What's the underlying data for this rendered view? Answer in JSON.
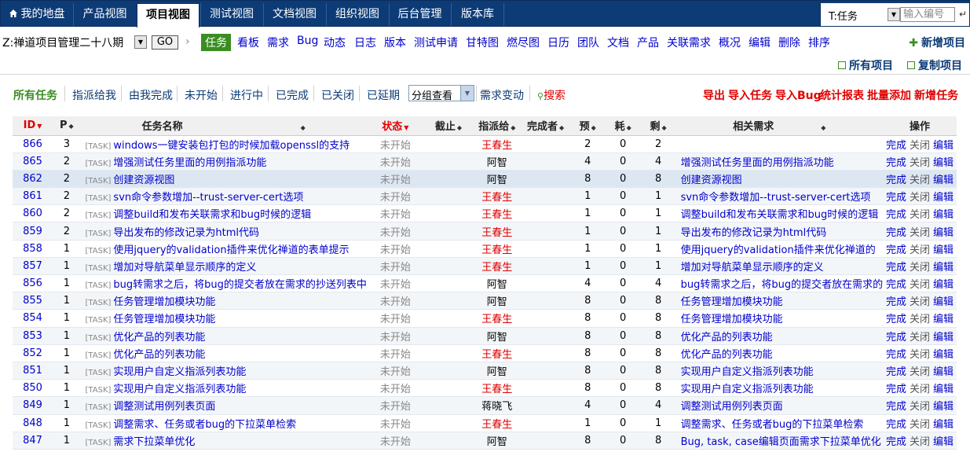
{
  "topnav": {
    "tabs": [
      {
        "label": "我的地盘",
        "icon": "home-icon"
      },
      {
        "label": "产品视图"
      },
      {
        "label": "项目视图",
        "active": true
      },
      {
        "label": "测试视图"
      },
      {
        "label": "文档视图"
      },
      {
        "label": "组织视图"
      },
      {
        "label": "后台管理"
      },
      {
        "label": "版本库"
      }
    ],
    "type_select": "T:任务",
    "number_placeholder": "输入编号"
  },
  "subnav": {
    "project_name": "Z:禅道项目管理二十八期",
    "go_label": "GO",
    "links": [
      "任务",
      "看板",
      "需求",
      "Bug",
      "动态",
      "日志",
      "版本",
      "测试申请",
      "甘特图",
      "燃尽图",
      "日历",
      "团队",
      "文档",
      "产品",
      "关联需求",
      "概况",
      "编辑",
      "删除",
      "排序"
    ],
    "add_project": "新增项目",
    "all_projects": "所有项目",
    "copy_project": "复制项目"
  },
  "filters": {
    "items": [
      "所有任务",
      "指派给我",
      "由我完成",
      "未开始",
      "进行中",
      "已完成",
      "已关闭",
      "已延期"
    ],
    "group_select": "分组查看",
    "story_change": "需求变动",
    "search": "搜索",
    "actions": [
      "导出",
      "导入任务",
      "导入Bug",
      "统计报表",
      "批量添加",
      "新增任务"
    ]
  },
  "table": {
    "headers": [
      "ID",
      "P",
      "任务名称",
      "状态",
      "截止",
      "指派给",
      "完成者",
      "预",
      "耗",
      "剩",
      "相关需求",
      "操作"
    ],
    "tag": "[TASK]",
    "action_labels": {
      "done": "完成",
      "close": "关闭",
      "edit": "编辑"
    },
    "rows": [
      {
        "id": "866",
        "p": "3",
        "name": "windows一键安装包打包的时候加载openssl的支持",
        "status": "未开始",
        "assign": "王春生",
        "est": "2",
        "used": "0",
        "left": "2",
        "story": ""
      },
      {
        "id": "865",
        "p": "2",
        "name": "增强测试任务里面的用例指派功能",
        "status": "未开始",
        "assign": "阿智",
        "est": "4",
        "used": "0",
        "left": "4",
        "story": "增强测试任务里面的用例指派功能"
      },
      {
        "id": "862",
        "p": "2",
        "name": "创建资源视图",
        "status": "未开始",
        "assign": "阿智",
        "est": "8",
        "used": "0",
        "left": "8",
        "story": "创建资源视图"
      },
      {
        "id": "861",
        "p": "2",
        "name": "svn命令参数增加--trust-server-cert选项",
        "status": "未开始",
        "assign": "王春生",
        "est": "1",
        "used": "0",
        "left": "1",
        "story": "svn命令参数增加--trust-server-cert选项"
      },
      {
        "id": "860",
        "p": "2",
        "name": "调整build和发布关联需求和bug时候的逻辑",
        "status": "未开始",
        "assign": "王春生",
        "est": "1",
        "used": "0",
        "left": "1",
        "story": "调整build和发布关联需求和bug时候的逻辑"
      },
      {
        "id": "859",
        "p": "2",
        "name": "导出发布的修改记录为html代码",
        "status": "未开始",
        "assign": "王春生",
        "est": "1",
        "used": "0",
        "left": "1",
        "story": "导出发布的修改记录为html代码"
      },
      {
        "id": "858",
        "p": "1",
        "name": "使用jquery的validation插件来优化禅道的表单提示",
        "status": "未开始",
        "assign": "王春生",
        "est": "1",
        "used": "0",
        "left": "1",
        "story": "使用jquery的validation插件来优化禅道的"
      },
      {
        "id": "857",
        "p": "1",
        "name": "增加对导航菜单显示顺序的定义",
        "status": "未开始",
        "assign": "王春生",
        "est": "1",
        "used": "0",
        "left": "1",
        "story": "增加对导航菜单显示顺序的定义"
      },
      {
        "id": "856",
        "p": "1",
        "name": "bug转需求之后，将bug的提交者放在需求的抄送列表中",
        "status": "未开始",
        "assign": "阿智",
        "est": "4",
        "used": "0",
        "left": "4",
        "story": "bug转需求之后，将bug的提交者放在需求的"
      },
      {
        "id": "855",
        "p": "1",
        "name": "任务管理增加模块功能",
        "status": "未开始",
        "assign": "阿智",
        "est": "8",
        "used": "0",
        "left": "8",
        "story": "任务管理增加模块功能"
      },
      {
        "id": "854",
        "p": "1",
        "name": "任务管理增加模块功能",
        "status": "未开始",
        "assign": "王春生",
        "est": "8",
        "used": "0",
        "left": "8",
        "story": "任务管理增加模块功能"
      },
      {
        "id": "853",
        "p": "1",
        "name": "优化产品的列表功能",
        "status": "未开始",
        "assign": "阿智",
        "est": "8",
        "used": "0",
        "left": "8",
        "story": "优化产品的列表功能"
      },
      {
        "id": "852",
        "p": "1",
        "name": "优化产品的列表功能",
        "status": "未开始",
        "assign": "王春生",
        "est": "8",
        "used": "0",
        "left": "8",
        "story": "优化产品的列表功能"
      },
      {
        "id": "851",
        "p": "1",
        "name": "实现用户自定义指派列表功能",
        "status": "未开始",
        "assign": "阿智",
        "est": "8",
        "used": "0",
        "left": "8",
        "story": "实现用户自定义指派列表功能"
      },
      {
        "id": "850",
        "p": "1",
        "name": "实现用户自定义指派列表功能",
        "status": "未开始",
        "assign": "王春生",
        "est": "8",
        "used": "0",
        "left": "8",
        "story": "实现用户自定义指派列表功能"
      },
      {
        "id": "849",
        "p": "1",
        "name": "调整测试用例列表页面",
        "status": "未开始",
        "assign": "蒋晓飞",
        "est": "4",
        "used": "0",
        "left": "4",
        "story": "调整测试用例列表页面"
      },
      {
        "id": "848",
        "p": "1",
        "name": "调整需求、任务或者bug的下拉菜单检索",
        "status": "未开始",
        "assign": "王春生",
        "est": "1",
        "used": "0",
        "left": "1",
        "story": "调整需求、任务或者bug的下拉菜单检索"
      },
      {
        "id": "847",
        "p": "1",
        "name": "需求下拉菜单优化",
        "status": "未开始",
        "assign": "阿智",
        "est": "8",
        "used": "0",
        "left": "8",
        "story": "Bug, task, case编辑页面需求下拉菜单优化"
      }
    ]
  }
}
